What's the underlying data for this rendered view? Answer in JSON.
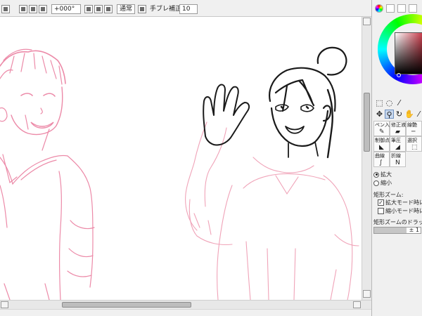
{
  "toolbar": {
    "rotation_value": "+000°",
    "blend_mode": "通常",
    "stabilizer_label": "手ブレ補正",
    "stabilizer_value": "10"
  },
  "panel": {
    "brush_tools": [
      {
        "label": "ペン入れ",
        "icon": "pen-icon"
      },
      {
        "label": "修正液",
        "icon": "correction-fluid-icon"
      },
      {
        "label": "線艶",
        "icon": "line-gloss-icon"
      },
      {
        "label": "制御点",
        "icon": "control-point-icon"
      },
      {
        "label": "筆圧",
        "icon": "pressure-icon"
      },
      {
        "label": "選択",
        "icon": "select-icon"
      },
      {
        "label": "曲線",
        "icon": "curve-icon"
      },
      {
        "label": "折線",
        "icon": "polyline-icon"
      }
    ],
    "zoom_in_label": "拡大",
    "zoom_out_label": "縮小",
    "rect_zoom_heading": "矩形ズーム:",
    "zoom_in_mode_label": "拡大モード時にす",
    "zoom_out_mode_label": "縮小モード時にす",
    "drag_heading": "矩形ズームのドラッグ粘",
    "slider_value_text": "± 1"
  },
  "colors": {
    "sketch_line": "#ec8aa8",
    "ink_line": "#1a1a1a",
    "canvas_bg": "#ffffff"
  }
}
